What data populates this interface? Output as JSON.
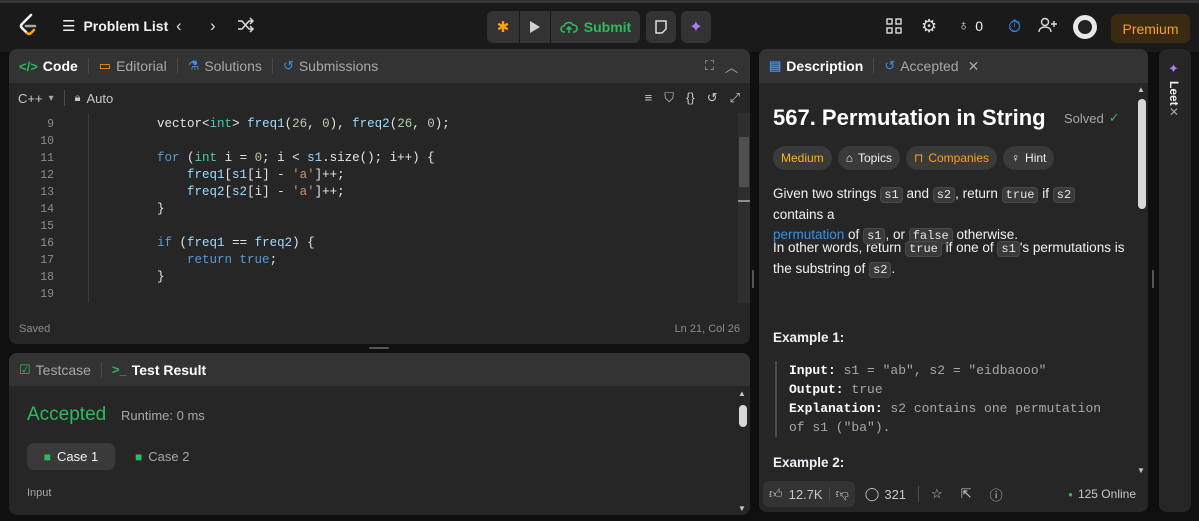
{
  "topbar": {
    "problem_list": "Problem List",
    "submit": "Submit",
    "streak_count": "0",
    "premium": "Premium"
  },
  "colors": {
    "accent_green": "#2cbb5d",
    "premium": "#ffa116",
    "medium": "#ffb800",
    "link": "#3b8fe8"
  },
  "code_panel": {
    "tabs": [
      "Code",
      "Editorial",
      "Solutions",
      "Submissions"
    ],
    "language": "C++",
    "mode": "Auto",
    "lines": [
      {
        "n": "9",
        "indent": "        ",
        "tokens": [
          [
            "vector",
            "plain"
          ],
          [
            "<",
            "plain"
          ],
          [
            "int",
            "tp"
          ],
          [
            "> ",
            "plain"
          ],
          [
            "freq1",
            "var"
          ],
          [
            "(",
            "plain"
          ],
          [
            "26",
            "num"
          ],
          [
            ", ",
            "plain"
          ],
          [
            "0",
            "num"
          ],
          [
            "), ",
            "plain"
          ],
          [
            "freq2",
            "var"
          ],
          [
            "(",
            "plain"
          ],
          [
            "26",
            "num"
          ],
          [
            ", ",
            "plain"
          ],
          [
            "0",
            "num"
          ],
          [
            ");",
            "plain"
          ]
        ]
      },
      {
        "n": "10",
        "indent": "",
        "tokens": []
      },
      {
        "n": "11",
        "indent": "        ",
        "tokens": [
          [
            "for",
            "kw"
          ],
          [
            " (",
            "plain"
          ],
          [
            "int",
            "tp"
          ],
          [
            " i = ",
            "plain"
          ],
          [
            "0",
            "num"
          ],
          [
            "; i < ",
            "plain"
          ],
          [
            "s1",
            "var"
          ],
          [
            ".size(); i++) {",
            "plain"
          ]
        ]
      },
      {
        "n": "12",
        "indent": "            ",
        "tokens": [
          [
            "freq1",
            "var"
          ],
          [
            "[",
            "plain"
          ],
          [
            "s1",
            "var"
          ],
          [
            "[i] - ",
            "plain"
          ],
          [
            "'a'",
            "str"
          ],
          [
            "]++;",
            "plain"
          ]
        ]
      },
      {
        "n": "13",
        "indent": "            ",
        "tokens": [
          [
            "freq2",
            "var"
          ],
          [
            "[",
            "plain"
          ],
          [
            "s2",
            "var"
          ],
          [
            "[i] - ",
            "plain"
          ],
          [
            "'a'",
            "str"
          ],
          [
            "]++;",
            "plain"
          ]
        ]
      },
      {
        "n": "14",
        "indent": "        ",
        "tokens": [
          [
            "}",
            "plain"
          ]
        ]
      },
      {
        "n": "15",
        "indent": "",
        "tokens": []
      },
      {
        "n": "16",
        "indent": "        ",
        "tokens": [
          [
            "if",
            "kw"
          ],
          [
            " (",
            "plain"
          ],
          [
            "freq1",
            "var"
          ],
          [
            " == ",
            "plain"
          ],
          [
            "freq2",
            "var"
          ],
          [
            ") {",
            "plain"
          ]
        ]
      },
      {
        "n": "17",
        "indent": "            ",
        "tokens": [
          [
            "return",
            "kw"
          ],
          [
            " ",
            "plain"
          ],
          [
            "true",
            "kw"
          ],
          [
            ";",
            "plain"
          ]
        ]
      },
      {
        "n": "18",
        "indent": "        ",
        "tokens": [
          [
            "}",
            "plain"
          ]
        ]
      },
      {
        "n": "19",
        "indent": "",
        "tokens": []
      }
    ],
    "status": "Saved",
    "cursor": "Ln 21, Col 26"
  },
  "test_panel": {
    "tabs": [
      "Testcase",
      "Test Result"
    ],
    "result": "Accepted",
    "runtime": "Runtime: 0 ms",
    "cases": [
      "Case 1",
      "Case 2"
    ],
    "input_label": "Input"
  },
  "desc_panel": {
    "tabs": [
      "Description",
      "Accepted"
    ],
    "title": "567. Permutation in String",
    "solved": "Solved",
    "difficulty": "Medium",
    "tags": [
      "Topics",
      "Companies",
      "Hint"
    ],
    "p1": {
      "a": "Given two strings ",
      "s1": "s1",
      "b": " and ",
      "s2": "s2",
      "c": ", return ",
      "t": "true",
      "d": " if ",
      "s2b": "s2",
      "e": " contains a",
      "link": "permutation",
      "f": " of ",
      "s1b": "s1",
      "g": ", or ",
      "fl": "false",
      "h": " otherwise."
    },
    "p2": {
      "a": "In other words, return ",
      "t": "true",
      "b": " if one of ",
      "s1": "s1",
      "c": "'s permutations is",
      "d": "the substring of ",
      "s2": "s2",
      "e": "."
    },
    "example1_title": "Example 1:",
    "ex_input_label": "Input:",
    "ex_input": " s1 = \"ab\", s2 = \"eidbaooo\"",
    "ex_output_label": "Output:",
    "ex_output": " true",
    "ex_expl_label": "Explanation:",
    "ex_expl1": " s2 contains one permutation",
    "ex_expl2": "of s1 (\"ba\").",
    "example2_title": "Example 2:",
    "likes": "12.7K",
    "comments": "321",
    "online": "125 Online"
  },
  "side": {
    "leet": "Leet"
  }
}
